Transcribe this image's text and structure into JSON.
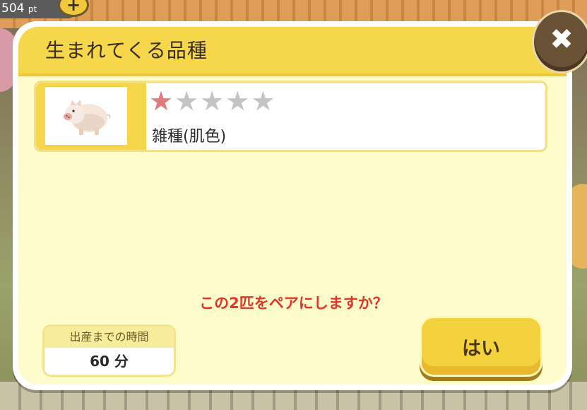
{
  "hud": {
    "points_value": "504",
    "points_unit": "pt",
    "plus_label": "+"
  },
  "dialog": {
    "title": "生まれてくる品種",
    "close_label": "✖",
    "breed": {
      "rarity": 1,
      "rarity_max": 5,
      "name": "雑種(肌色)"
    },
    "question": "この2匹をペアにしますか？",
    "time": {
      "label": "出産までの時間",
      "value": "60 分"
    },
    "yes_label": "はい"
  },
  "colors": {
    "header": "#f6d64a",
    "panel": "#fffccb",
    "star_on": "#de7c7c",
    "star_off": "#c4c4c4",
    "question_text": "#e0362a"
  }
}
